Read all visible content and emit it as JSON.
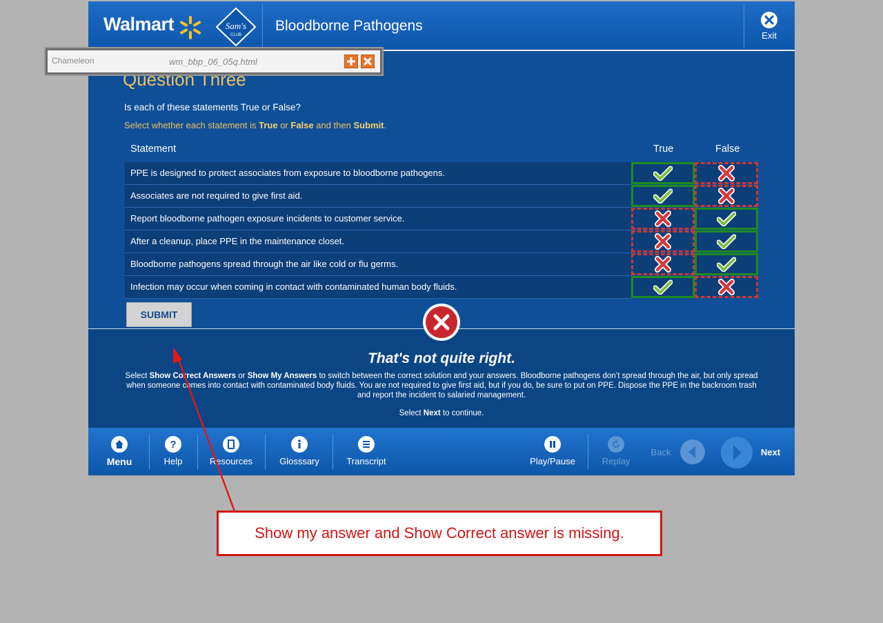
{
  "header": {
    "brand": "Walmart",
    "sams_text": "Sam's",
    "sams_sub": "CLUB",
    "course_title": "Bloodborne Pathogens",
    "exit_label": "Exit"
  },
  "toolbar": {
    "logo_text": "Chameleon",
    "filename": "wm_bbp_06_05q.html"
  },
  "question": {
    "title": "Question Three",
    "prompt": "Is each of these statements True or False?",
    "instruction_pre": "Select whether each statement is ",
    "instruction_true": "True",
    "instruction_or": " or ",
    "instruction_false": "False",
    "instruction_mid": " and then ",
    "instruction_submit": "Submit",
    "instruction_end": ".",
    "col_statement": "Statement",
    "col_true": "True",
    "col_false": "False",
    "rows": [
      {
        "text": "PPE is designed to protect associates from exposure to bloodborne pathogens.",
        "true_mark": "check-icon",
        "false_mark": "x-icon",
        "selected": "true"
      },
      {
        "text": "Associates are not required to give first aid.",
        "true_mark": "check-icon",
        "false_mark": "x-icon",
        "selected": "true"
      },
      {
        "text": "Report bloodborne pathogen exposure incidents to customer service.",
        "true_mark": "x-icon",
        "false_mark": "check-icon",
        "selected": "false"
      },
      {
        "text": "After a cleanup, place PPE in the maintenance closet.",
        "true_mark": "x-icon",
        "false_mark": "check-icon",
        "selected": "false"
      },
      {
        "text": "Bloodborne pathogens spread through the air like cold or flu germs.",
        "true_mark": "x-icon",
        "false_mark": "check-icon",
        "selected": "false"
      },
      {
        "text": "Infection may occur when coming in contact with contaminated human body fluids.",
        "true_mark": "check-icon",
        "false_mark": "x-icon",
        "selected": "true"
      }
    ],
    "submit_label": "SUBMIT"
  },
  "feedback": {
    "title": "That's not quite right.",
    "body_1": "Select ",
    "body_show_correct": "Show Correct Answers",
    "body_2": " or ",
    "body_show_mine": "Show My Answers",
    "body_3": " to switch between the correct solution and your answers.  Bloodborne pathogens don’t spread through the air, but only spread when someone comes into contact with contaminated body fluids.  You are not required to give first aid, but if you do, be sure to put on PPE.  Dispose the PPE in the backroom trash and report the incident to salaried management.",
    "next_pre": "Select ",
    "next_word": "Next",
    "next_post": " to continue."
  },
  "nav": {
    "menu": "Menu",
    "help": "Help",
    "resources": "Resources",
    "glossary": "Glosssary",
    "transcript": "Transcript",
    "playpause": "Play/Pause",
    "replay": "Replay",
    "back": "Back",
    "next": "Next"
  },
  "annotation": {
    "note": "Show my answer and Show Correct answer is missing."
  },
  "colors": {
    "course_blue": "#0f4f97",
    "gold": "#f0c060",
    "check_green": "#7bc043",
    "x_red": "#d63a3a",
    "annotation_red": "#d41414"
  }
}
